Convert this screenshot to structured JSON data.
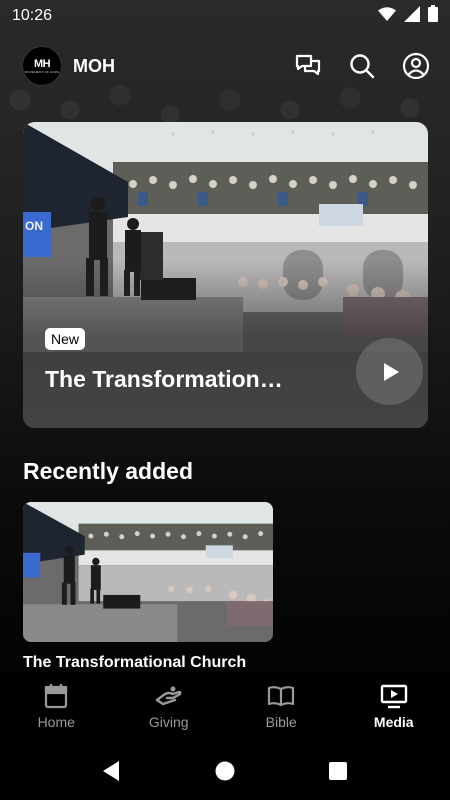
{
  "status_bar": {
    "time": "10:26",
    "icons": [
      "wifi-icon",
      "cellular-signal-icon",
      "battery-icon"
    ]
  },
  "header": {
    "logo_mark": "MH",
    "logo_subtext": "MOVEMENT OF HOPE",
    "title": "MOH",
    "actions": [
      "chat-icon",
      "search-icon",
      "account-icon"
    ]
  },
  "hero": {
    "badge": "New",
    "title": "The Transformation…",
    "action": "play-icon"
  },
  "recently_added": {
    "heading": "Recently added",
    "items": [
      {
        "title": "The Transformational Church"
      }
    ]
  },
  "bottom_nav": {
    "items": [
      {
        "label": "Home",
        "icon": "calendar-icon",
        "active": false
      },
      {
        "label": "Giving",
        "icon": "giving-hand-icon",
        "active": false
      },
      {
        "label": "Bible",
        "icon": "book-icon",
        "active": false
      },
      {
        "label": "Media",
        "icon": "tv-play-icon",
        "active": true
      }
    ]
  },
  "system_nav": {
    "buttons": [
      "back-icon",
      "home-icon",
      "recents-icon"
    ]
  },
  "colors": {
    "background": "#000000",
    "text": "#ffffff",
    "inactive_nav": "#9a9a9a",
    "badge_bg": "#ffffff"
  }
}
